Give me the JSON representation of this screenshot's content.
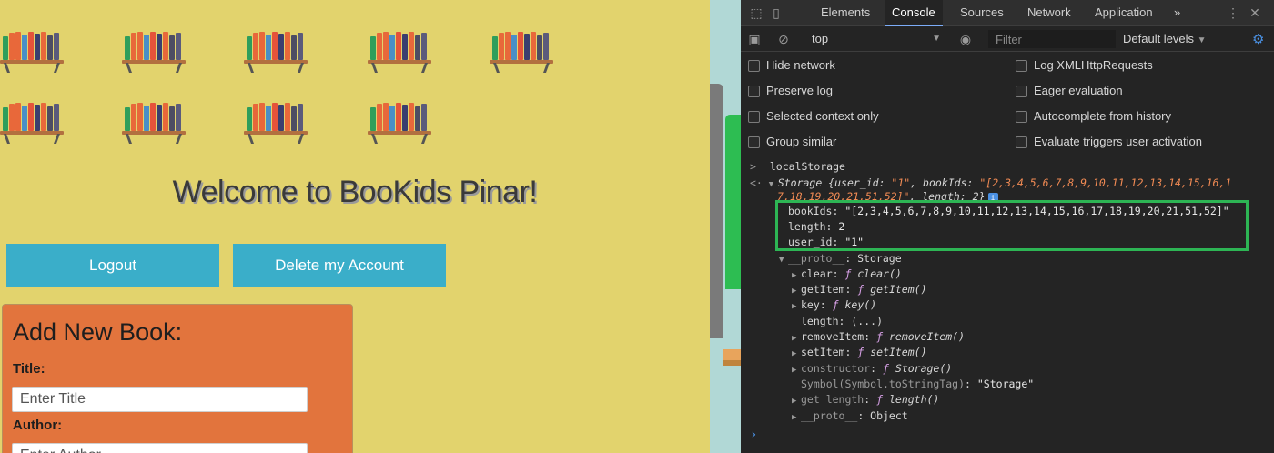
{
  "page": {
    "welcome": "Welcome to BooKids Pinar!",
    "logout_label": "Logout",
    "delete_label": "Delete my Account",
    "add_book": {
      "heading": "Add New Book:",
      "title_label": "Title:",
      "title_placeholder": "Enter Title",
      "author_label": "Author:",
      "author_placeholder": "Enter Author"
    },
    "colors": {
      "background": "#e2d36d",
      "button": "#3aaec9",
      "panel": "#e2743d"
    }
  },
  "devtools": {
    "tabs": [
      "Elements",
      "Console",
      "Sources",
      "Network",
      "Application"
    ],
    "active_tab": "Console",
    "more_tabs_icon": "»",
    "context": "top",
    "filter_placeholder": "Filter",
    "levels": "Default levels",
    "settings_left": [
      "Hide network",
      "Preserve log",
      "Selected context only",
      "Group similar"
    ],
    "settings_right": [
      "Log XMLHttpRequests",
      "Eager evaluation",
      "Autocomplete from history",
      "Evaluate triggers user activation"
    ],
    "console": {
      "input": "localStorage",
      "summary_prefix": "Storage {user_id: ",
      "summary_user_id": "\"1\"",
      "summary_bookids_key": ", bookIds: ",
      "summary_bookids_1": "\"[2,3,4,5,6,7,8,9,10,11,12,13,14,15,16,1",
      "summary_bookids_2": "7,18,19,20,21,51,52]\"",
      "summary_length": ", length: 2}",
      "bookIds_key": "bookIds: ",
      "bookIds_value": "\"[2,3,4,5,6,7,8,9,10,11,12,13,14,15,16,17,18,19,20,21,51,52]\"",
      "length_key": "length: ",
      "length_value": "2",
      "user_id_key": "user_id: ",
      "user_id_value": "\"1\"",
      "proto_key": "__proto__",
      "proto_value": ": Storage",
      "methods": [
        {
          "key": "clear",
          "value": "clear()"
        },
        {
          "key": "getItem",
          "value": "getItem()"
        },
        {
          "key": "key",
          "value": "key()"
        }
      ],
      "length_getter": "length: (...)",
      "methods2": [
        {
          "key": "removeItem",
          "value": "removeItem()"
        },
        {
          "key": "setItem",
          "value": "setItem()"
        },
        {
          "key": "constructor",
          "value": "Storage()"
        }
      ],
      "symbol_key": "Symbol(Symbol.toStringTag)",
      "symbol_value": "\"Storage\"",
      "get_length_key": "get length",
      "get_length_value": "length()",
      "proto2_key": "__proto__",
      "proto2_value": ": Object"
    }
  }
}
